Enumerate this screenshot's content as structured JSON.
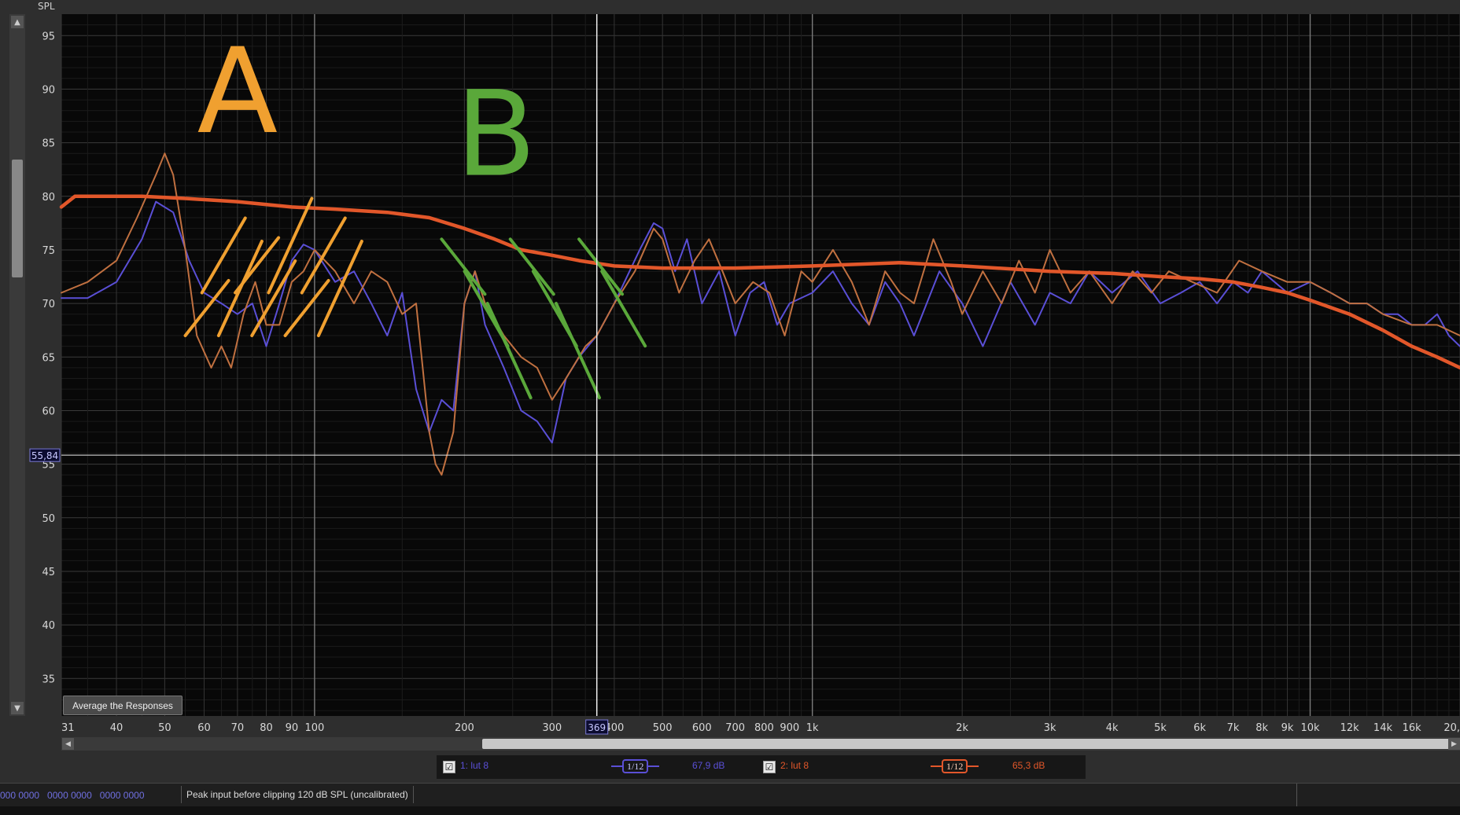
{
  "chart_data": {
    "type": "line",
    "title": "",
    "ylabel": "SPL",
    "xlabel": "",
    "xscale": "log",
    "xlim": [
      31,
      20000
    ],
    "ylim": [
      31.5,
      97
    ],
    "yticks": [
      95,
      90,
      85,
      80,
      75,
      70,
      65,
      60,
      55,
      50,
      45,
      40,
      35
    ],
    "xticks": [
      {
        "v": 31,
        "label": "31"
      },
      {
        "v": 40,
        "label": "40"
      },
      {
        "v": 50,
        "label": "50"
      },
      {
        "v": 60,
        "label": "60"
      },
      {
        "v": 70,
        "label": "70"
      },
      {
        "v": 80,
        "label": "80"
      },
      {
        "v": 90,
        "label": "90"
      },
      {
        "v": 100,
        "label": "100"
      },
      {
        "v": 200,
        "label": "200"
      },
      {
        "v": 300,
        "label": "300"
      },
      {
        "v": 400,
        "label": "400"
      },
      {
        "v": 500,
        "label": "500"
      },
      {
        "v": 600,
        "label": "600"
      },
      {
        "v": 700,
        "label": "700"
      },
      {
        "v": 800,
        "label": "800"
      },
      {
        "v": 900,
        "label": "900"
      },
      {
        "v": 1000,
        "label": "1k"
      },
      {
        "v": 2000,
        "label": "2k"
      },
      {
        "v": 3000,
        "label": "3k"
      },
      {
        "v": 4000,
        "label": "4k"
      },
      {
        "v": 5000,
        "label": "5k"
      },
      {
        "v": 6000,
        "label": "6k"
      },
      {
        "v": 7000,
        "label": "7k"
      },
      {
        "v": 8000,
        "label": "8k"
      },
      {
        "v": 9000,
        "label": "9k"
      },
      {
        "v": 10000,
        "label": "10k"
      },
      {
        "v": 12000,
        "label": "12k"
      },
      {
        "v": 14000,
        "label": "14k"
      },
      {
        "v": 16000,
        "label": "16k"
      },
      {
        "v": 20000,
        "label": "20,"
      }
    ],
    "cursor": {
      "x": 369,
      "x_label": "369",
      "y": 55.84,
      "y_label": "55,84"
    },
    "grid": true,
    "series": [
      {
        "name": "1: lut 8",
        "color": "#5a4fd6",
        "x": [
          31,
          35,
          40,
          45,
          48,
          52,
          56,
          60,
          65,
          70,
          75,
          80,
          85,
          90,
          95,
          100,
          110,
          120,
          130,
          140,
          150,
          160,
          170,
          180,
          190,
          200,
          210,
          220,
          240,
          260,
          280,
          300,
          320,
          340,
          369,
          400,
          450,
          480,
          500,
          530,
          560,
          600,
          650,
          700,
          750,
          800,
          850,
          900,
          1000,
          1100,
          1200,
          1300,
          1400,
          1500,
          1600,
          1800,
          2000,
          2200,
          2500,
          2800,
          3000,
          3300,
          3600,
          4000,
          4500,
          5000,
          5500,
          6000,
          6500,
          7000,
          7500,
          8000,
          9000,
          10000,
          11000,
          12000,
          13000,
          14000,
          15000,
          16000,
          17000,
          18000,
          19000,
          20000
        ],
        "y": [
          70.5,
          70.5,
          72,
          76,
          79.5,
          78.5,
          74,
          71,
          70,
          69,
          70,
          66,
          70,
          74,
          75.5,
          75,
          72,
          73,
          70,
          67,
          71,
          62,
          58,
          61,
          60,
          70,
          73,
          68,
          64,
          60,
          59,
          57,
          63,
          65,
          67,
          70,
          75,
          77.5,
          77,
          73,
          76,
          70,
          73,
          67,
          71,
          72,
          68,
          70,
          71,
          73,
          70,
          68,
          72,
          70,
          67,
          73,
          70,
          66,
          72,
          68,
          71,
          70,
          73,
          71,
          73,
          70,
          71,
          72,
          70,
          72,
          71,
          73,
          71,
          72,
          71,
          70,
          70,
          69,
          69,
          68,
          68,
          69,
          67,
          66
        ]
      },
      {
        "name": "2: lut 8",
        "color": "#c07040",
        "x": [
          31,
          35,
          40,
          44,
          48,
          50,
          52,
          55,
          58,
          62,
          65,
          68,
          72,
          76,
          80,
          85,
          90,
          95,
          100,
          110,
          120,
          130,
          140,
          150,
          160,
          170,
          175,
          180,
          190,
          200,
          210,
          220,
          240,
          260,
          280,
          300,
          320,
          350,
          369,
          400,
          440,
          480,
          500,
          540,
          580,
          620,
          660,
          700,
          760,
          820,
          880,
          950,
          1000,
          1100,
          1200,
          1300,
          1400,
          1500,
          1600,
          1750,
          1900,
          2000,
          2200,
          2400,
          2600,
          2800,
          3000,
          3300,
          3600,
          4000,
          4400,
          4800,
          5200,
          5800,
          6500,
          7200,
          8000,
          9000,
          10000,
          11000,
          12000,
          13000,
          14000,
          16000,
          18000,
          20000
        ],
        "y": [
          71,
          72,
          74,
          78,
          82,
          84,
          82,
          75,
          67,
          64,
          66,
          64,
          69,
          72,
          68,
          68,
          72,
          73,
          75,
          73,
          70,
          73,
          72,
          69,
          70,
          58,
          55,
          54,
          58,
          70,
          73,
          70,
          67,
          65,
          64,
          61,
          63,
          66,
          67,
          70,
          73,
          77,
          76,
          71,
          74,
          76,
          73,
          70,
          72,
          71,
          67,
          73,
          72,
          75,
          72,
          68,
          73,
          71,
          70,
          76,
          72,
          69,
          73,
          70,
          74,
          71,
          75,
          71,
          73,
          70,
          73,
          71,
          73,
          72,
          71,
          74,
          73,
          72,
          72,
          71,
          70,
          70,
          69,
          68,
          68,
          67
        ]
      },
      {
        "name": "Average",
        "color": "#e2572a",
        "x": [
          31,
          33,
          38,
          45,
          55,
          70,
          90,
          110,
          140,
          170,
          200,
          230,
          260,
          300,
          340,
          400,
          500,
          700,
          1000,
          1500,
          2000,
          3000,
          4000,
          5000,
          6000,
          7000,
          8000,
          9000,
          10000,
          12000,
          14000,
          16000,
          18000,
          20000
        ],
        "y": [
          79,
          80,
          80,
          80,
          79.8,
          79.5,
          79,
          78.8,
          78.5,
          78,
          77,
          76,
          75,
          74.5,
          74,
          73.5,
          73.3,
          73.3,
          73.5,
          73.8,
          73.5,
          73,
          72.8,
          72.5,
          72.3,
          72,
          71.5,
          71,
          70.3,
          69,
          67.5,
          66,
          65,
          64
        ]
      }
    ],
    "annotations": [
      {
        "text": "A",
        "color": "#f0a030",
        "type": "hatched region",
        "x": [
          55,
          110
        ]
      },
      {
        "text": "B",
        "color": "#5aa83a",
        "type": "hatched region",
        "x": [
          180,
          420
        ]
      }
    ]
  },
  "ui": {
    "average_button_label": "Average the Responses",
    "scroll_up": "▲",
    "scroll_down": "▼",
    "scroll_left": "◀",
    "scroll_right": "▶"
  },
  "legend": {
    "r1_check": "☑",
    "r1_label": "1: lut 8",
    "r1_smoothing": "1/12",
    "r1_level": "67,9 dB",
    "r2_check": "☑",
    "r2_label": "2: lut 8",
    "r2_smoothing": "1/12",
    "r2_level": "65,3 dB",
    "colors": {
      "r1": "#5a4fd6",
      "r2": "#e2572a"
    }
  },
  "status": {
    "digits": "000 0000   0000 0000   0000 0000",
    "message": "Peak input before clipping 120 dB SPL (uncalibrated)"
  }
}
